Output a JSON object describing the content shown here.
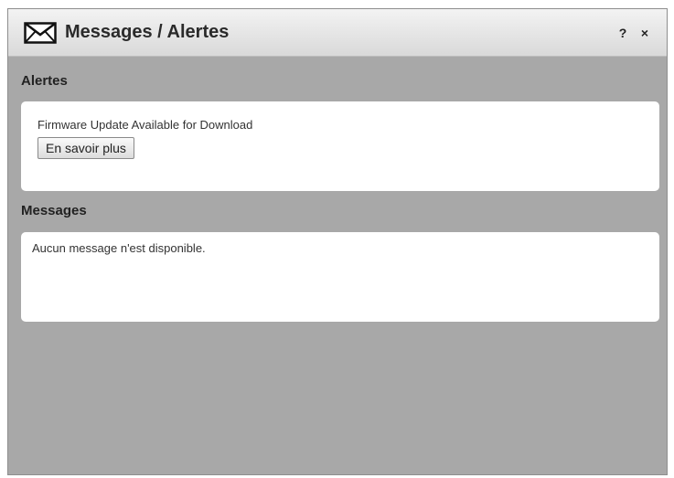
{
  "dialog": {
    "title": "Messages / Alertes",
    "icon": "envelope-icon",
    "help_label": "?",
    "close_label": "×"
  },
  "alertes": {
    "heading": "Alertes",
    "items": [
      {
        "text": "Firmware Update Available for Download",
        "button_label": "En savoir plus"
      }
    ]
  },
  "messages": {
    "heading": "Messages",
    "empty_text": "Aucun message n'est disponible."
  },
  "colors": {
    "background": "#a8a8a8",
    "card": "#ffffff",
    "titlebar": "#e6e6e6"
  }
}
